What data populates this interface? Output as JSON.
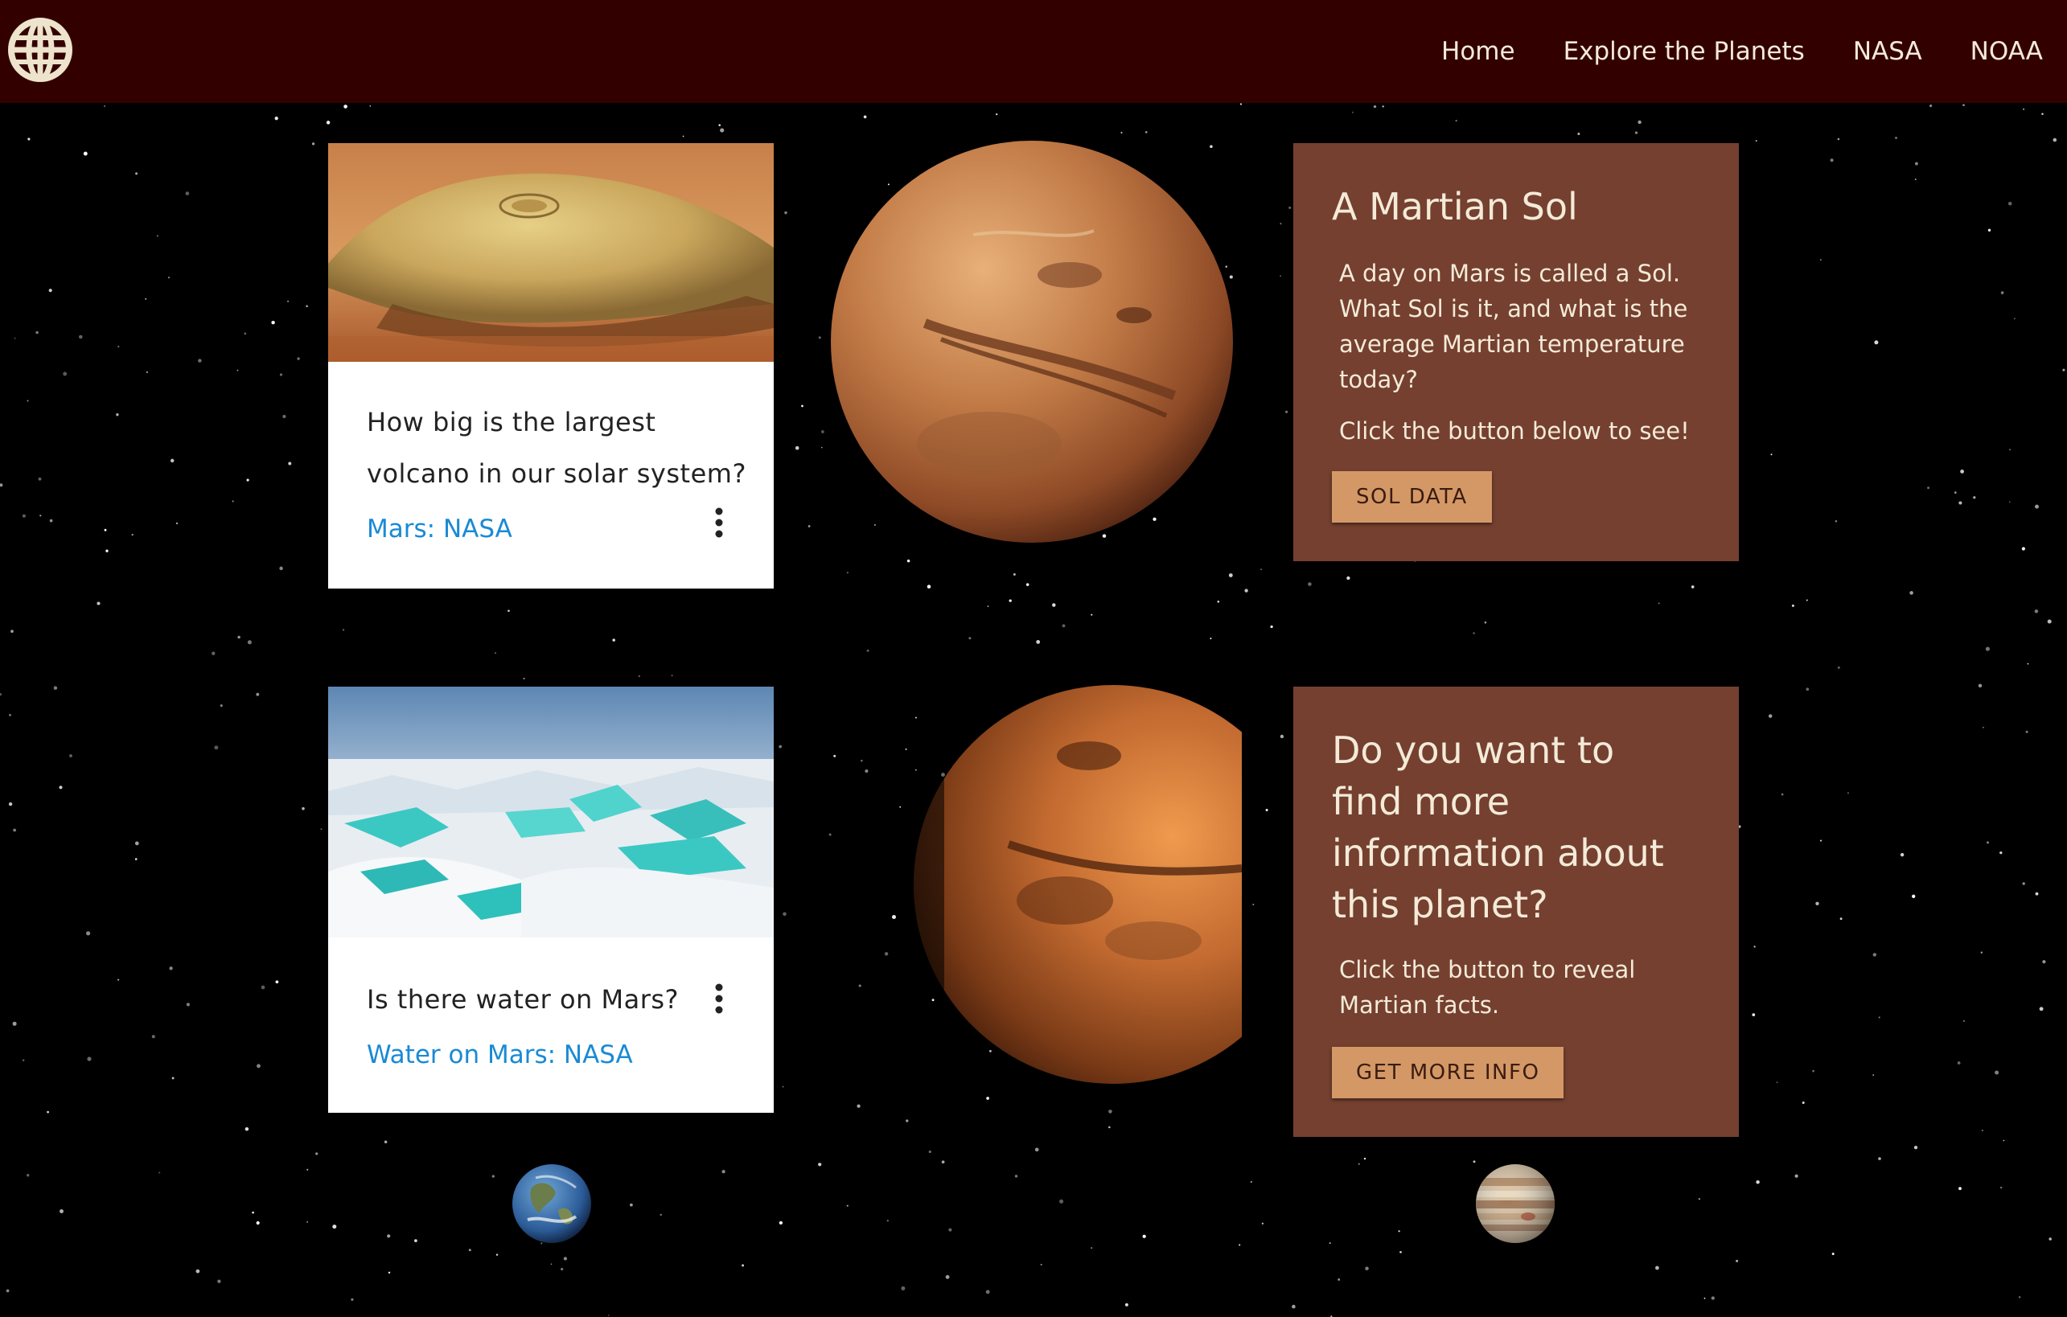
{
  "nav": {
    "logo_icon": "globe-icon",
    "links": [
      "Home",
      "Explore the Planets",
      "NASA",
      "NOAA"
    ]
  },
  "cards": [
    {
      "title_line1": "How big is the largest",
      "title_line2": "volcano in our solar system?",
      "link": "Mars: NASA",
      "image": "olympus-mons-volcano-image",
      "menu_icon": "more-vertical-icon"
    },
    {
      "title": "Is there water on Mars?",
      "link": "Water on Mars: NASA",
      "image": "ice-landscape-image",
      "menu_icon": "more-vertical-icon"
    }
  ],
  "panels": [
    {
      "title": "A Martian Sol",
      "text_lines": [
        "A day on Mars is called a Sol.",
        "What Sol is it, and what is the",
        "average Martian temperature",
        "today?"
      ],
      "prompt": "Click the button below to see!",
      "button": "SOL DATA"
    },
    {
      "title_lines": [
        "Do you want to",
        "find more",
        "information about",
        "this planet?"
      ],
      "text_lines": [
        "Click the button to reveal",
        "Martian facts."
      ],
      "button": "GET MORE INFO"
    }
  ],
  "planets": [
    "mars-image",
    "mars-image",
    "earth-image",
    "jupiter-image"
  ],
  "colors": {
    "header": "#330000",
    "panel": "#754030",
    "button": "#d49866",
    "link": "#1a8ad4",
    "background": "#000000"
  }
}
